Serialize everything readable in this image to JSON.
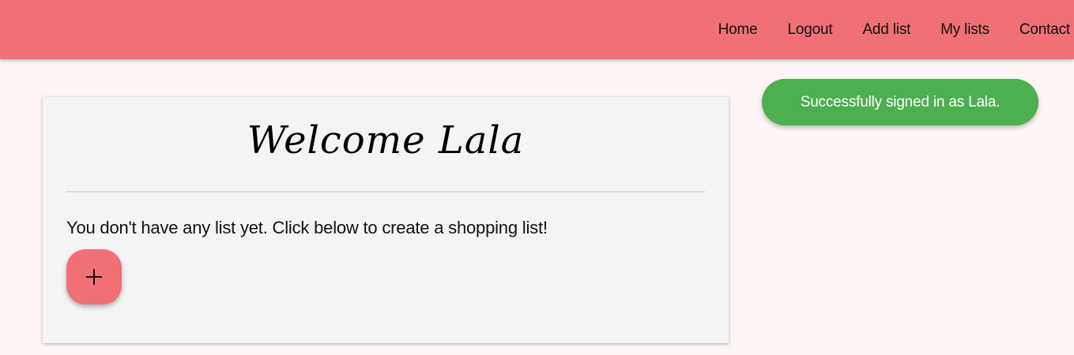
{
  "nav": {
    "items": [
      {
        "label": "Home"
      },
      {
        "label": "Logout"
      },
      {
        "label": "Add list"
      },
      {
        "label": "My lists"
      },
      {
        "label": "Contact"
      }
    ]
  },
  "main": {
    "welcome": "Welcome Lala",
    "empty_message": "You don't have any list yet. Click below to create a shopping list!",
    "add_button_icon": "plus-icon"
  },
  "toast": {
    "message": "Successfully signed in as Lala."
  },
  "colors": {
    "accent": "#f07075",
    "background": "#fff5f4",
    "card": "#f4f4f4",
    "success": "#4caf50"
  }
}
